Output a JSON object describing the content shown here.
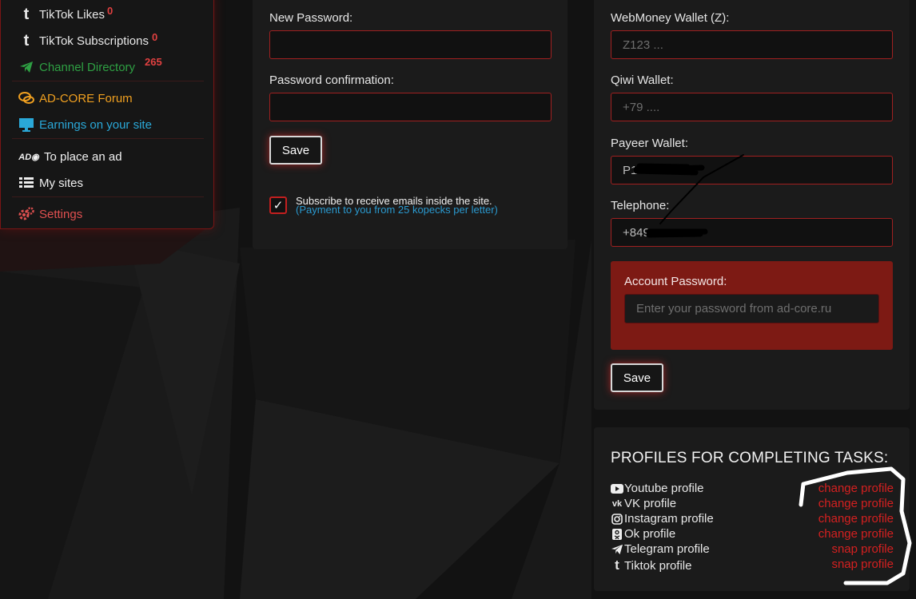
{
  "sidebar": {
    "items": [
      {
        "label": "TikTok Likes",
        "count": "0",
        "icon": "tiktok-icon"
      },
      {
        "label": "TikTok Subscriptions",
        "count": "0",
        "icon": "tiktok-icon"
      },
      {
        "label": "Channel Directory",
        "count": "265",
        "icon": "telegram-icon"
      },
      {
        "label": "AD-CORE Forum",
        "icon": "chat-bubbles-icon"
      },
      {
        "label": "Earnings on your site",
        "icon": "monitor-icon"
      },
      {
        "label": "To place an ad",
        "icon": "ad-icon"
      },
      {
        "label": "My sites",
        "icon": "list-icon"
      },
      {
        "label": "Settings",
        "icon": "gears-icon"
      }
    ]
  },
  "password_panel": {
    "new_password_label": "New Password:",
    "confirmation_label": "Password confirmation:",
    "save_label": "Save",
    "subscribe_checked": "✓",
    "subscribe_text": "Subscribe to receive emails inside the site.",
    "subscribe_note": "(Payment to you from 25 kopecks per letter)"
  },
  "wallet_panel": {
    "webmoney_label": "WebMoney Wallet (Z):",
    "webmoney_placeholder": "Z123 ...",
    "qiwi_label": "Qiwi Wallet:",
    "qiwi_placeholder": "+79 ....",
    "payeer_label": "Payeer Wallet:",
    "payeer_value": "P1",
    "telephone_label": "Telephone:",
    "telephone_value": "+849",
    "account_password_label": "Account Password:",
    "account_password_placeholder": "Enter your password from ad-core.ru",
    "save_label": "Save"
  },
  "profiles": {
    "title": "PROFILES FOR COMPLETING TASKS:",
    "rows": [
      {
        "name": "Youtube profile",
        "action": "change profile",
        "icon": "youtube-icon"
      },
      {
        "name": "VK profile",
        "action": "change profile",
        "icon": "vk-icon"
      },
      {
        "name": "Instagram profile",
        "action": "change profile",
        "icon": "instagram-icon"
      },
      {
        "name": "Ok profile",
        "action": "change profile",
        "icon": "ok-icon"
      },
      {
        "name": "Telegram profile",
        "action": "snap profile",
        "icon": "telegram-icon"
      },
      {
        "name": "Tiktok profile",
        "action": "snap profile",
        "icon": "tiktok-icon"
      }
    ]
  },
  "colors": {
    "accent_red": "#c21f1f",
    "link_green": "#2ea043",
    "link_orange": "#f0a020",
    "link_blue": "#2aa8d8",
    "settings_red": "#e05050"
  }
}
